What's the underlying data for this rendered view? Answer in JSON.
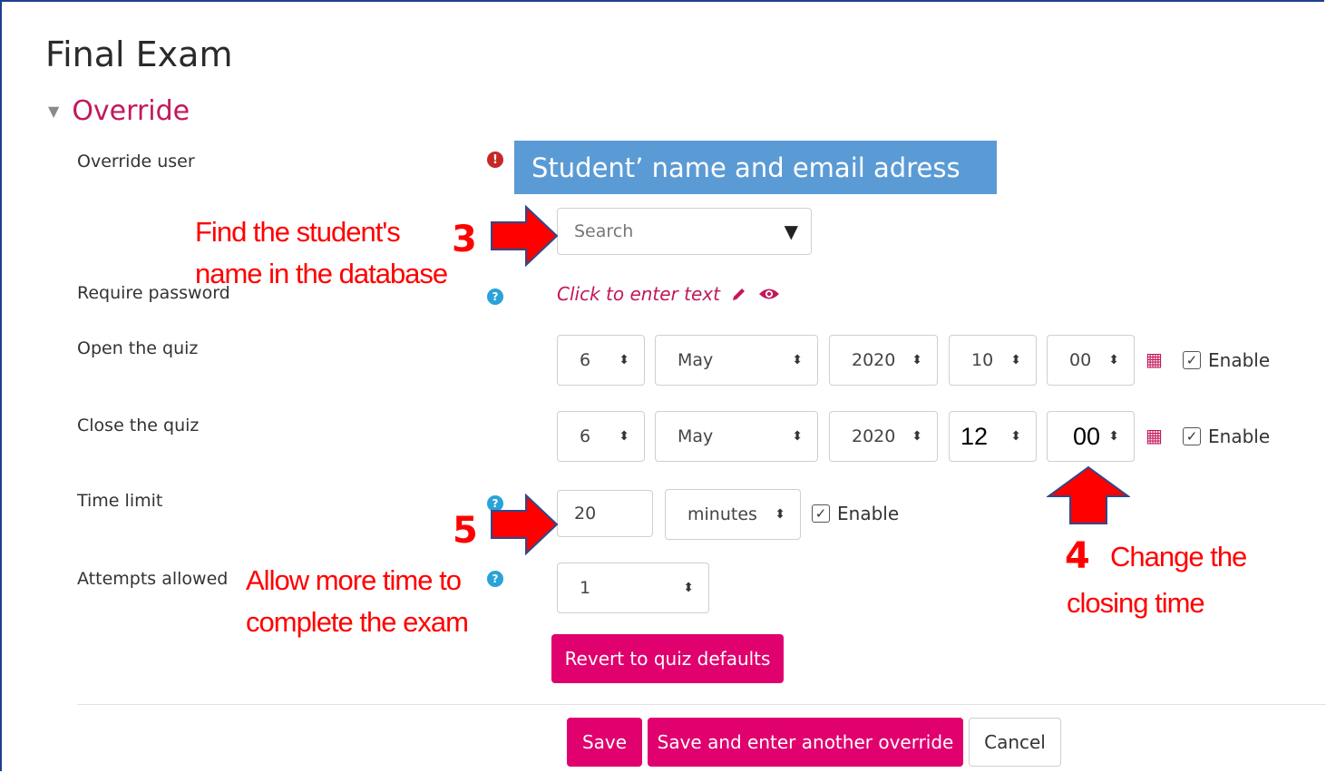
{
  "page": {
    "title": "Final Exam"
  },
  "section": {
    "legend": "Override"
  },
  "fields": {
    "override_user": {
      "label": "Override user",
      "placeholder": "Search"
    },
    "require_password": {
      "label": "Require password",
      "link": "Click to enter text"
    },
    "open_quiz": {
      "label": "Open the quiz",
      "day": "6",
      "month": "May",
      "year": "2020",
      "hour": "10",
      "minute": "00",
      "enable_label": "Enable"
    },
    "close_quiz": {
      "label": "Close the quiz",
      "day": "6",
      "month": "May",
      "year": "2020",
      "hour": "12",
      "minute": "00",
      "enable_label": "Enable"
    },
    "time_limit": {
      "label": "Time limit",
      "value": "20",
      "unit": "minutes",
      "enable_label": "Enable"
    },
    "attempts": {
      "label": "Attempts allowed",
      "value": "1"
    }
  },
  "buttons": {
    "revert": "Revert to quiz defaults",
    "save": "Save",
    "save_another": "Save and enter another override",
    "cancel": "Cancel"
  },
  "annotations": {
    "callout": "Student’ name and email adress",
    "step3_num": "3",
    "step3_line1": "Find the student's",
    "step3_line2": "name in the database",
    "step4_num": "4",
    "step4_line1": "Change the",
    "step4_line2": "closing time",
    "step5_num": "5",
    "step5_line1": "Allow more time to",
    "step5_line2": "complete the exam"
  },
  "colors": {
    "accent": "#e0006e",
    "annotation": "#ff0000",
    "callout_bg": "#5b9bd5"
  }
}
